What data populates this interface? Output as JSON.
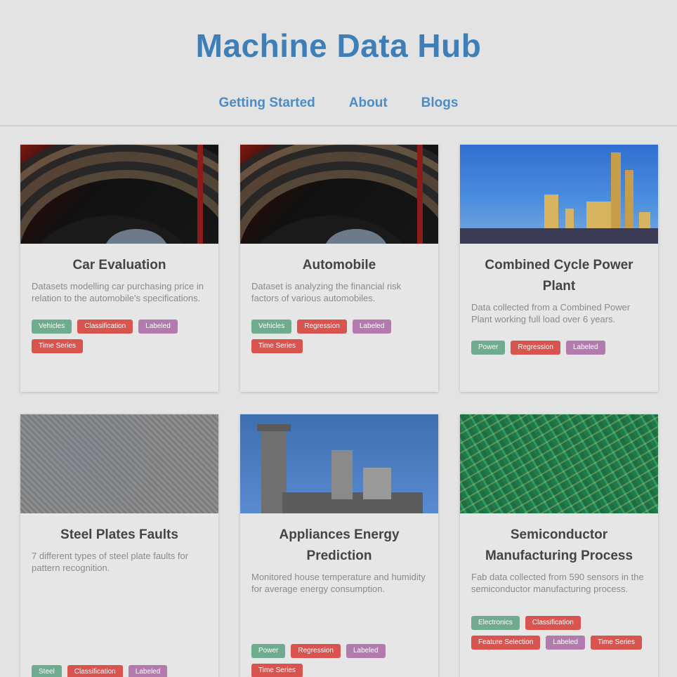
{
  "site": {
    "title": "Machine Data Hub"
  },
  "nav": [
    {
      "label": "Getting Started"
    },
    {
      "label": "About"
    },
    {
      "label": "Blogs"
    }
  ],
  "cards": [
    {
      "title": "Car Evaluation",
      "description": "Datasets modelling car purchasing price in relation to the automobile's specifications.",
      "image": "car-tire",
      "tags": [
        {
          "label": "Vehicles",
          "color": "#6fab8e"
        },
        {
          "label": "Classification",
          "color": "#d9534f"
        },
        {
          "label": "Labeled",
          "color": "#b27aad"
        },
        {
          "label": "Time Series",
          "color": "#d9534f"
        }
      ]
    },
    {
      "title": "Automobile",
      "description": "Dataset is analyzing the financial risk factors of various automobiles.",
      "image": "car-tire",
      "tags": [
        {
          "label": "Vehicles",
          "color": "#6fab8e"
        },
        {
          "label": "Regression",
          "color": "#d9534f"
        },
        {
          "label": "Labeled",
          "color": "#b27aad"
        },
        {
          "label": "Time Series",
          "color": "#d9534f"
        }
      ]
    },
    {
      "title": "Combined Cycle Power Plant",
      "description": "Data collected from a Combined Power Plant working full load over 6 years.",
      "image": "power-plant",
      "tags": [
        {
          "label": "Power",
          "color": "#6fab8e"
        },
        {
          "label": "Regression",
          "color": "#d9534f"
        },
        {
          "label": "Labeled",
          "color": "#b27aad"
        }
      ]
    },
    {
      "title": "Steel Plates Faults",
      "description": "7 different types of steel plate faults for pattern recognition.",
      "image": "steel-plate",
      "tags": [
        {
          "label": "Steel",
          "color": "#6fab8e"
        },
        {
          "label": "Classification",
          "color": "#d9534f"
        },
        {
          "label": "Labeled",
          "color": "#b27aad"
        }
      ]
    },
    {
      "title": "Appliances Energy Prediction",
      "description": "Monitored house temperature and humidity for average energy consumption.",
      "image": "tower",
      "tags": [
        {
          "label": "Power",
          "color": "#6fab8e"
        },
        {
          "label": "Regression",
          "color": "#d9534f"
        },
        {
          "label": "Labeled",
          "color": "#b27aad"
        },
        {
          "label": "Time Series",
          "color": "#d9534f"
        }
      ]
    },
    {
      "title": "Semiconductor Manufacturing Process",
      "description": "Fab data collected from 590 sensors in the semiconductor manufacturing process.",
      "image": "pcb",
      "tags": [
        {
          "label": "Electronics",
          "color": "#6fab8e"
        },
        {
          "label": "Classification",
          "color": "#d9534f"
        },
        {
          "label": "Feature Selection",
          "color": "#d9534f"
        },
        {
          "label": "Labeled",
          "color": "#b27aad"
        },
        {
          "label": "Time Series",
          "color": "#d9534f"
        }
      ]
    }
  ]
}
